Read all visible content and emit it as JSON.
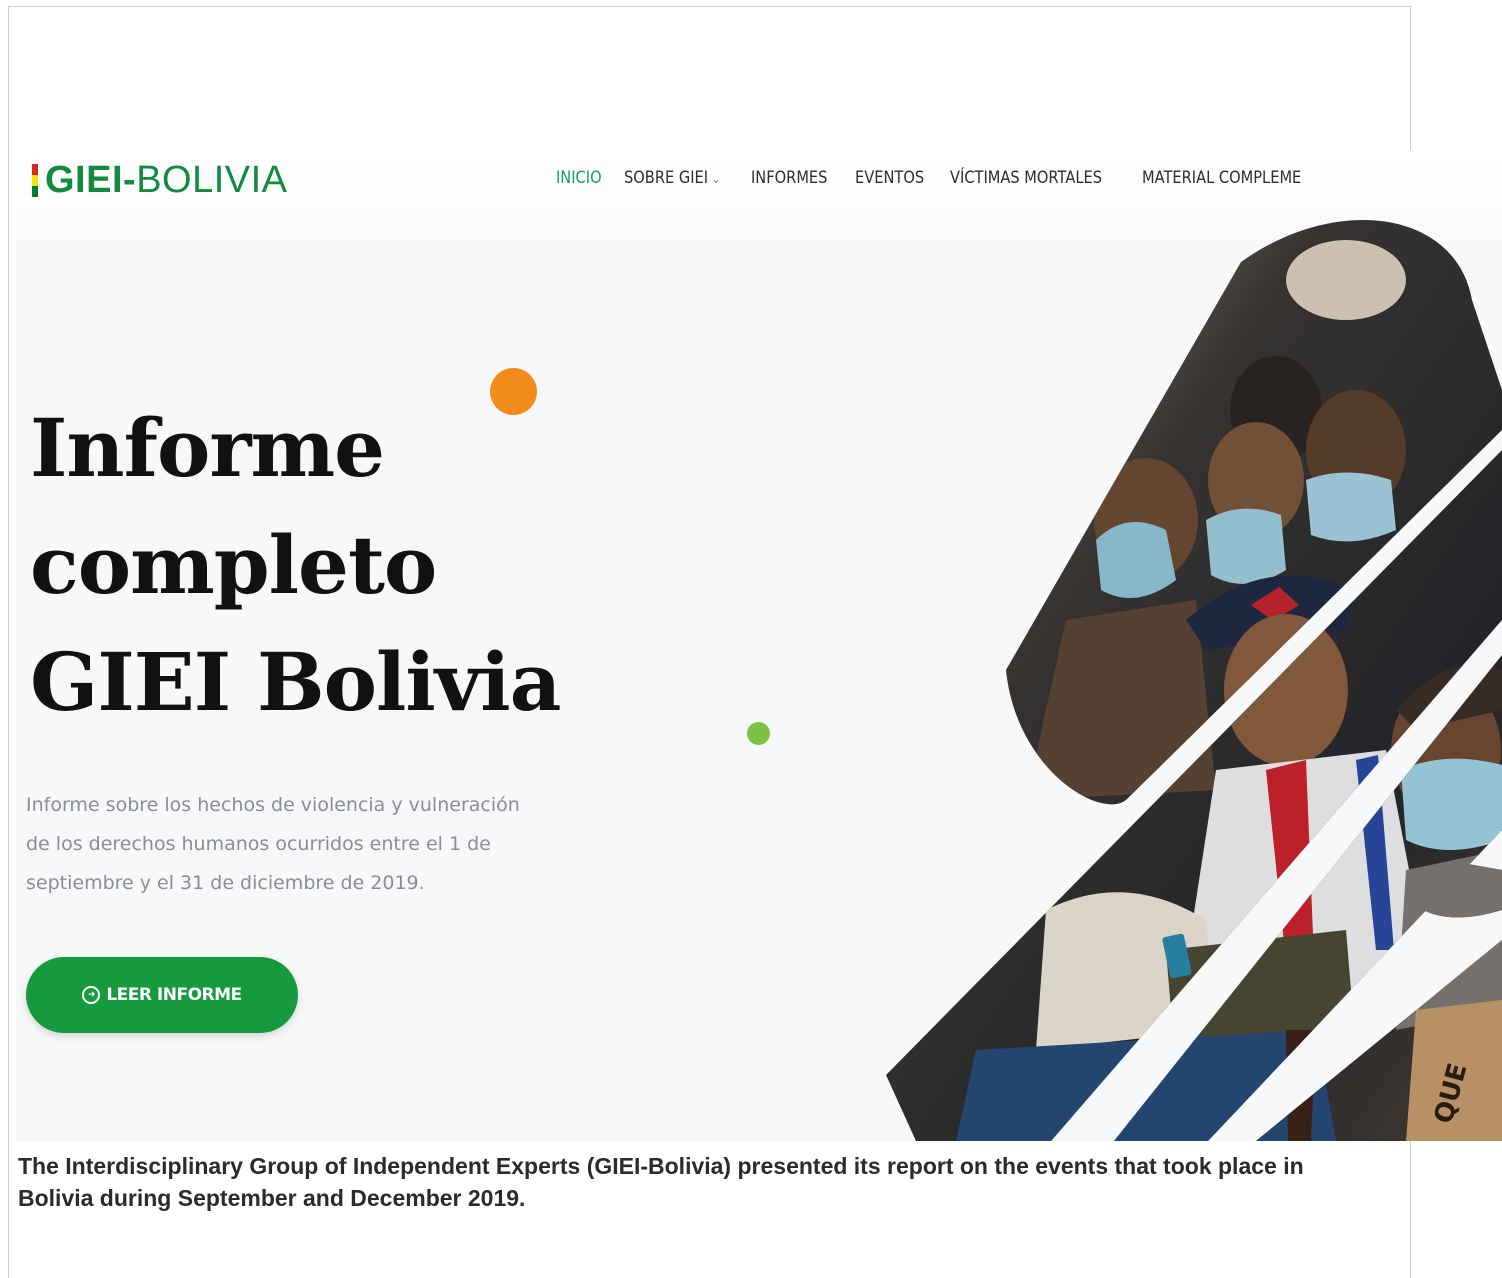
{
  "logo": {
    "bold": "GIEI-",
    "rest": "BOLIVIA",
    "flag_colors": [
      "#d52b1e",
      "#f9e300",
      "#007934"
    ]
  },
  "nav": {
    "items": [
      {
        "label": "INICIO",
        "active": true
      },
      {
        "label": "SOBRE GIEI",
        "has_dropdown": true
      },
      {
        "label": "INFORMES"
      },
      {
        "label": "EVENTOS"
      },
      {
        "label": "VÍCTIMAS MORTALES"
      },
      {
        "label": "MATERIAL COMPLEME"
      }
    ]
  },
  "hero": {
    "title_lines": [
      "Informe",
      "completo",
      "GIEI Bolivia"
    ],
    "description": "Informe sobre los hechos de violencia y vulneración de los derechos humanos ocurridos entre el 1 de septiembre y el 31 de diciembre de 2019.",
    "cta_label": "LEER INFORME",
    "photo_sign_text": "QUE"
  },
  "colors": {
    "accent_green": "#179a3f",
    "nav_active": "#12a15c",
    "dot_orange": "#f48c1c",
    "dot_green": "#7cc242"
  },
  "caption": "The Interdisciplinary Group of Independent Experts (GIEI-Bolivia) presented its report on the events that took place in Bolivia during September and December 2019."
}
